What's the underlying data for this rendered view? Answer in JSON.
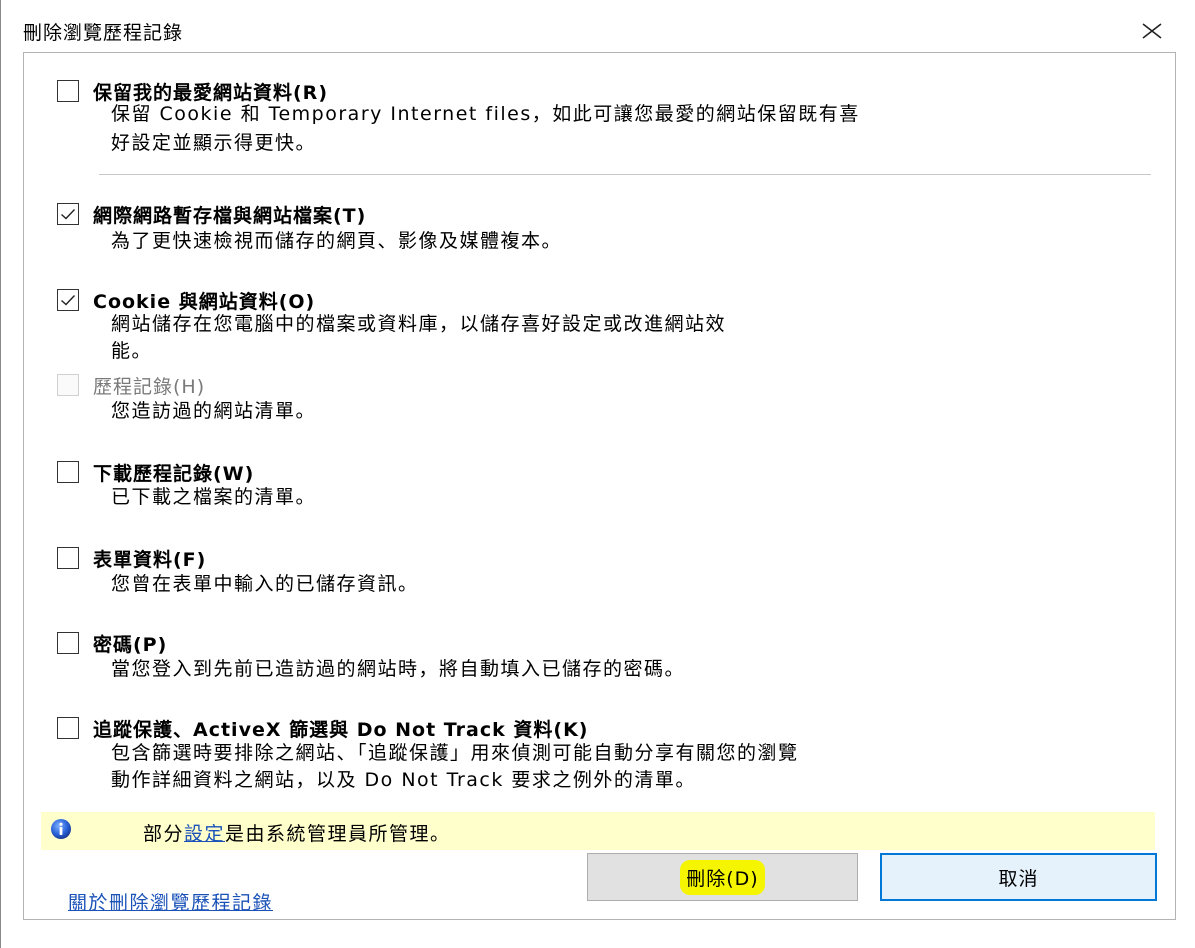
{
  "dialog": {
    "title": "刪除瀏覽歷程記錄",
    "close_icon": "close-icon"
  },
  "options": [
    {
      "label": "保留我的最愛網站資料(R)",
      "checked": false,
      "enabled": true,
      "desc": [
        "保留 Cookie 和 Temporary Internet files，如此可讓您最愛的網站保留既有喜",
        "好設定並顯示得更快。"
      ]
    },
    {
      "label": "網際網路暫存檔與網站檔案(T)",
      "checked": true,
      "enabled": true,
      "desc": [
        "為了更快速檢視而儲存的網頁、影像及媒體複本。"
      ]
    },
    {
      "label": "Cookie 與網站資料(O)",
      "checked": true,
      "enabled": true,
      "desc": [
        "網站儲存在您電腦中的檔案或資料庫，以儲存喜好設定或改進網站效",
        "能。"
      ]
    },
    {
      "label": "歷程記錄(H)",
      "checked": false,
      "enabled": false,
      "desc": [
        "您造訪過的網站清單。"
      ]
    },
    {
      "label": "下載歷程記錄(W)",
      "checked": false,
      "enabled": true,
      "desc": [
        "已下載之檔案的清單。"
      ]
    },
    {
      "label": "表單資料(F)",
      "checked": false,
      "enabled": true,
      "desc": [
        "您曾在表單中輸入的已儲存資訊。"
      ]
    },
    {
      "label": "密碼(P)",
      "checked": false,
      "enabled": true,
      "desc": [
        "當您登入到先前已造訪過的網站時，將自動填入已儲存的密碼。"
      ]
    },
    {
      "label": "追蹤保護、ActiveX 篩選與 Do Not Track 資料(K)",
      "checked": false,
      "enabled": true,
      "desc": [
        "包含篩選時要排除之網站、「追蹤保護」用來偵測可能自動分享有關您的瀏覽",
        "動作詳細資料之網站，以及 Do Not Track 要求之例外的清單。"
      ]
    }
  ],
  "info": {
    "icon": "info-icon",
    "prefix": "部分",
    "link": "設定",
    "suffix": "是由系統管理員所管理。"
  },
  "footer": {
    "help_link": "關於刪除瀏覽歷程記錄",
    "delete_label": "刪除(D)",
    "cancel_label": "取消"
  },
  "colors": {
    "link": "#1a52b8",
    "info_bg": "#ffffcc",
    "highlight": "#f5f500",
    "default_button_border": "#0078d7"
  }
}
